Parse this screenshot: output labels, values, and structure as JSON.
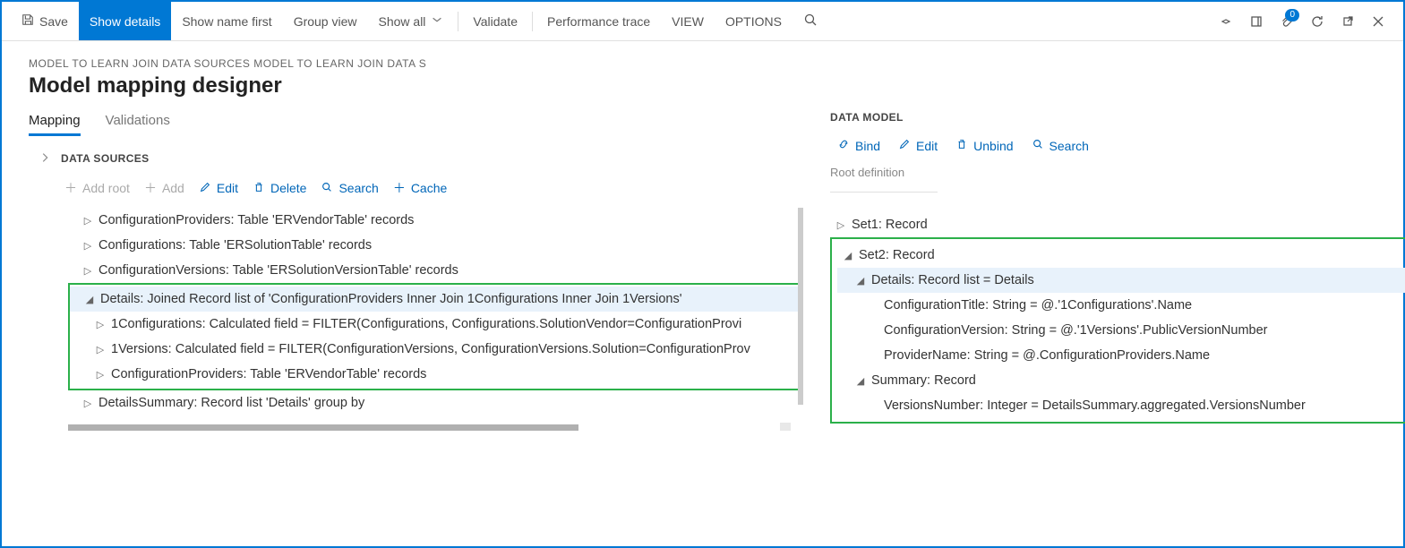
{
  "toolbar": {
    "save": "Save",
    "show_details": "Show details",
    "show_name_first": "Show name first",
    "group_view": "Group view",
    "show_all": "Show all",
    "validate": "Validate",
    "perf_trace": "Performance trace",
    "view": "VIEW",
    "options": "OPTIONS",
    "badge_count": "0"
  },
  "breadcrumb": "MODEL TO LEARN JOIN DATA SOURCES MODEL TO LEARN JOIN DATA S",
  "page_title": "Model mapping designer",
  "tabs": {
    "mapping": "Mapping",
    "validations": "Validations"
  },
  "left": {
    "section_title": "DATA SOURCES",
    "actions": {
      "add_root": "Add root",
      "add": "Add",
      "edit": "Edit",
      "delete": "Delete",
      "search": "Search",
      "cache": "Cache"
    },
    "tree": [
      {
        "label": "ConfigurationProviders: Table 'ERVendorTable' records",
        "indent": 0,
        "expanded": false
      },
      {
        "label": "Configurations: Table 'ERSolutionTable' records",
        "indent": 0,
        "expanded": false
      },
      {
        "label": "ConfigurationVersions: Table 'ERSolutionVersionTable' records",
        "indent": 0,
        "expanded": false
      }
    ],
    "highlighted": [
      {
        "label": "Details: Joined Record list of 'ConfigurationProviders Inner Join 1Configurations Inner Join 1Versions'",
        "indent": 0,
        "expanded": true,
        "selected": true
      },
      {
        "label": "1Configurations: Calculated field = FILTER(Configurations, Configurations.SolutionVendor=ConfigurationProvi",
        "indent": 1,
        "expanded": false
      },
      {
        "label": "1Versions: Calculated field = FILTER(ConfigurationVersions, ConfigurationVersions.Solution=ConfigurationProv",
        "indent": 1,
        "expanded": false
      },
      {
        "label": "ConfigurationProviders: Table 'ERVendorTable' records",
        "indent": 1,
        "expanded": false
      }
    ],
    "after": [
      {
        "label": "DetailsSummary: Record list 'Details' group by",
        "indent": 0,
        "expanded": false
      }
    ]
  },
  "right": {
    "section_title": "DATA MODEL",
    "actions": {
      "bind": "Bind",
      "edit": "Edit",
      "unbind": "Unbind",
      "search": "Search"
    },
    "root_def": "Root definition",
    "before": [
      {
        "label": "Set1: Record",
        "indent": 0,
        "expanded": false
      }
    ],
    "highlighted": [
      {
        "label": "Set2: Record",
        "indent": 0,
        "expanded": true
      },
      {
        "label": "Details: Record list = Details",
        "indent": 1,
        "expanded": true,
        "selected": true
      },
      {
        "label": "ConfigurationTitle: String = @.'1Configurations'.Name",
        "indent": 2
      },
      {
        "label": "ConfigurationVersion: String = @.'1Versions'.PublicVersionNumber",
        "indent": 2
      },
      {
        "label": "ProviderName: String = @.ConfigurationProviders.Name",
        "indent": 2
      },
      {
        "label": "Summary: Record",
        "indent": 1,
        "expanded": true
      },
      {
        "label": "VersionsNumber: Integer = DetailsSummary.aggregated.VersionsNumber",
        "indent": 2
      }
    ]
  }
}
